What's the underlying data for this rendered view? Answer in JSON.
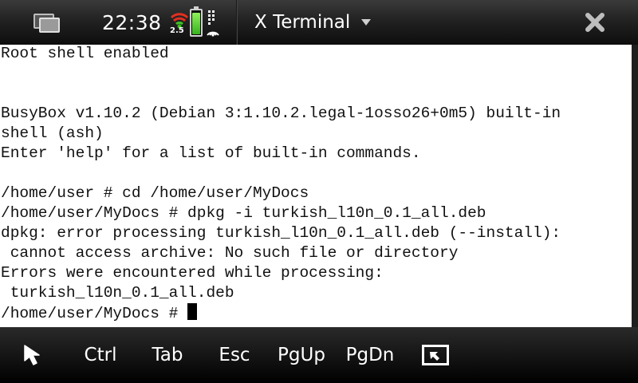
{
  "statusbar": {
    "time": "22:38",
    "network_label": "2.5",
    "window_title": "X Terminal",
    "icons": {
      "task_switcher": "task-switcher-icon",
      "signal": "signal-strength-icon",
      "battery": "battery-icon",
      "connection": "connection-icon",
      "menu": "chevron-down-icon",
      "close": "close-icon"
    },
    "battery_level": 1.0
  },
  "terminal": {
    "lines": [
      "Root shell enabled",
      "",
      "",
      "BusyBox v1.10.2 (Debian 3:1.10.2.legal-1osso26+0m5) built-in",
      "shell (ash)",
      "Enter 'help' for a list of built-in commands.",
      "",
      "/home/user # cd /home/user/MyDocs",
      "/home/user/MyDocs # dpkg -i turkish_l10n_0.1_all.deb",
      "dpkg: error processing turkish_l10n_0.1_all.deb (--install):",
      " cannot access archive: No such file or directory",
      "Errors were encountered while processing:",
      " turkish_l10n_0.1_all.deb"
    ],
    "prompt": "/home/user/MyDocs # "
  },
  "toolbar": {
    "pointer_icon": "pointer-arrow-icon",
    "ctrl_label": "Ctrl",
    "tab_label": "Tab",
    "esc_label": "Esc",
    "pgup_label": "PgUp",
    "pgdn_label": "PgDn",
    "fullscreen_icon": "fullscreen-icon"
  },
  "colors": {
    "terminal_bg": "#ffffff",
    "terminal_fg": "#111111",
    "bar_bg": "#1a1a1a",
    "battery_green": "#5bd12f",
    "signal_red": "#e03020",
    "signal_green": "#40c020"
  }
}
